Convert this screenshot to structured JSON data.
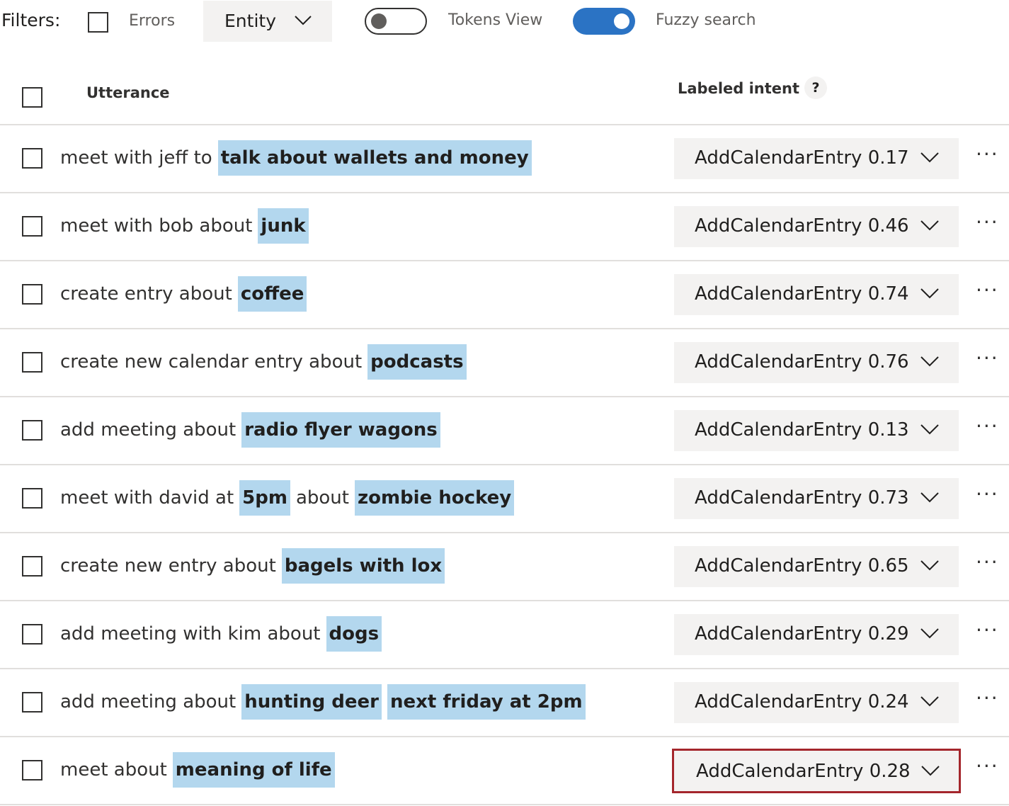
{
  "filters": {
    "label": "Filters:",
    "errors_label": "Errors",
    "entity_dropdown": "Entity",
    "tokens_view_label": "Tokens View",
    "tokens_view_on": false,
    "fuzzy_search_label": "Fuzzy search",
    "fuzzy_search_on": true
  },
  "header": {
    "utterance": "Utterance",
    "labeled_intent": "Labeled intent",
    "help": "?"
  },
  "colors": {
    "entity_highlight": "#b3d7ee",
    "toggle_on": "#2b73c4",
    "selected_border": "#a4262c"
  },
  "more_label": "···",
  "rows": [
    {
      "segments": [
        {
          "text": "meet with jeff to",
          "entity": false
        },
        {
          "text": "talk about wallets and money",
          "entity": true
        }
      ],
      "intent": "AddCalendarEntry 0.17"
    },
    {
      "segments": [
        {
          "text": "meet with bob about",
          "entity": false
        },
        {
          "text": "junk",
          "entity": true
        }
      ],
      "intent": "AddCalendarEntry 0.46"
    },
    {
      "segments": [
        {
          "text": "create entry about",
          "entity": false
        },
        {
          "text": "coffee",
          "entity": true
        }
      ],
      "intent": "AddCalendarEntry 0.74"
    },
    {
      "segments": [
        {
          "text": "create new calendar entry about",
          "entity": false
        },
        {
          "text": "podcasts",
          "entity": true
        }
      ],
      "intent": "AddCalendarEntry 0.76"
    },
    {
      "segments": [
        {
          "text": "add meeting about",
          "entity": false
        },
        {
          "text": "radio flyer wagons",
          "entity": true
        }
      ],
      "intent": "AddCalendarEntry 0.13"
    },
    {
      "segments": [
        {
          "text": "meet with david at",
          "entity": false
        },
        {
          "text": "5pm",
          "entity": true
        },
        {
          "text": "about",
          "entity": false
        },
        {
          "text": "zombie hockey",
          "entity": true
        }
      ],
      "intent": "AddCalendarEntry 0.73"
    },
    {
      "segments": [
        {
          "text": "create new entry about",
          "entity": false
        },
        {
          "text": "bagels with lox",
          "entity": true
        }
      ],
      "intent": "AddCalendarEntry 0.65"
    },
    {
      "segments": [
        {
          "text": "add meeting with kim about",
          "entity": false
        },
        {
          "text": "dogs",
          "entity": true
        }
      ],
      "intent": "AddCalendarEntry 0.29"
    },
    {
      "segments": [
        {
          "text": "add meeting about",
          "entity": false
        },
        {
          "text": "hunting deer",
          "entity": true
        },
        {
          "text": "next friday at 2pm",
          "entity": true
        }
      ],
      "intent": "AddCalendarEntry 0.24"
    },
    {
      "segments": [
        {
          "text": "meet about",
          "entity": false
        },
        {
          "text": "meaning of life",
          "entity": true
        }
      ],
      "intent": "AddCalendarEntry 0.28",
      "selected": true
    }
  ]
}
